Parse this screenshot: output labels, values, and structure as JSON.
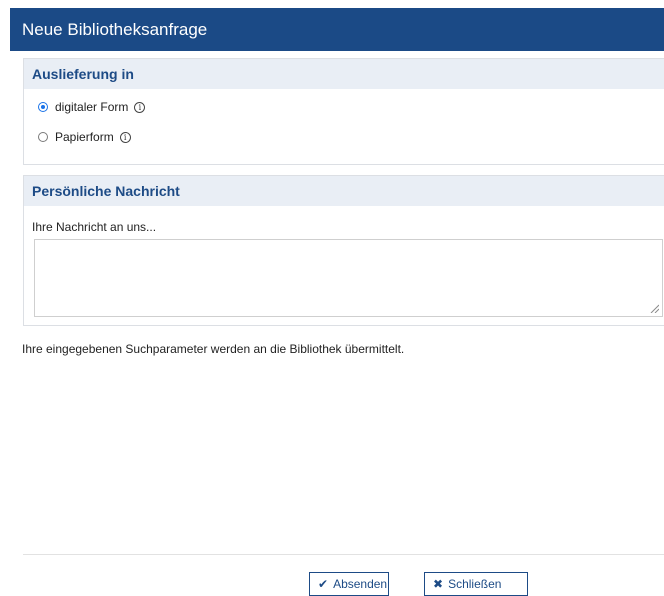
{
  "dialog": {
    "title": "Neue Bibliotheksanfrage"
  },
  "delivery": {
    "header": "Auslieferung in",
    "options": [
      {
        "label": "digitaler Form",
        "selected": true,
        "info_icon": "info-circle-icon"
      },
      {
        "label": "Papierform",
        "selected": false,
        "info_icon": "info-circle-icon"
      }
    ]
  },
  "message": {
    "header": "Persönliche Nachricht",
    "label": "Ihre Nachricht an uns...",
    "value": ""
  },
  "note": "Ihre eingegebenen Suchparameter werden an die Bibliothek übermittelt.",
  "buttons": {
    "send_label": "Absenden",
    "send_icon": "check-icon",
    "close_label": "Schließen",
    "close_icon": "x-icon"
  },
  "colors": {
    "titlebar": "#1b4a86",
    "panel_header_bg": "#e9eef5",
    "accent": "#1d4b86",
    "radio_selected": "#1a73e8"
  }
}
